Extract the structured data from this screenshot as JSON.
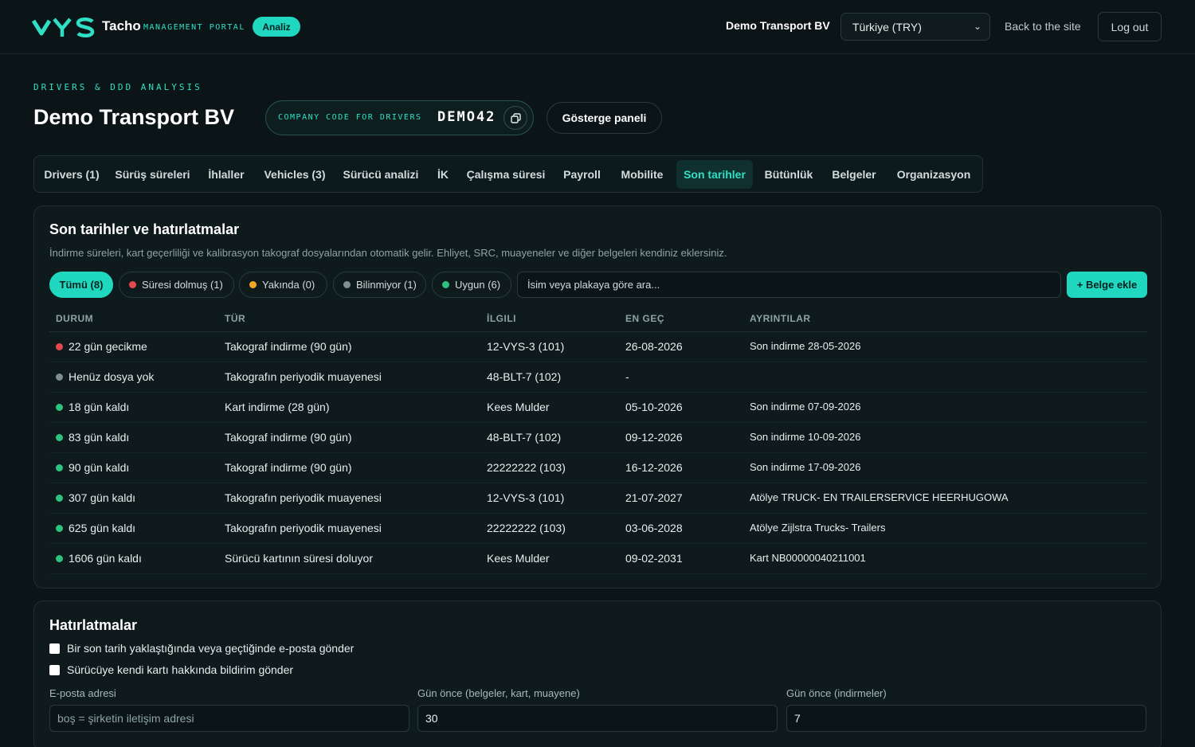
{
  "header": {
    "logo_text": "VYS",
    "brand": "Tacho",
    "portal_label": "MANAGEMENT PORTAL",
    "badge": "Analiz",
    "company": "Demo Transport BV",
    "currency_selected": "Türkiye (TRY)",
    "back_link": "Back to the site",
    "logout": "Log out"
  },
  "page": {
    "eyebrow": "DRIVERS & DDD ANALYSIS",
    "title": "Demo Transport BV",
    "code_label": "COMPANY CODE FOR DRIVERS",
    "code_value": "DEMO42",
    "dashboard_button": "Gösterge paneli"
  },
  "tabs": [
    {
      "label": "Drivers (1)"
    },
    {
      "label": "Sürüş süreleri"
    },
    {
      "label": "İhlaller"
    },
    {
      "label": "Vehicles (3)"
    },
    {
      "label": "Sürücü analizi"
    },
    {
      "label": "İK"
    },
    {
      "label": "Çalışma süresi"
    },
    {
      "label": "Payroll"
    },
    {
      "label": "Mobilite"
    },
    {
      "label": "Son tarihler",
      "active": true
    },
    {
      "label": "Bütünlük"
    },
    {
      "label": "Belgeler"
    },
    {
      "label": "Organizasyon"
    }
  ],
  "deadlines": {
    "title": "Son tarihler ve hatırlatmalar",
    "subtitle": "İndirme süreleri, kart geçerliliği ve kalibrasyon takograf dosyalarından otomatik gelir. Ehliyet, SRC, muayeneler ve diğer belgeleri kendiniz eklersiniz.",
    "filters": [
      {
        "label": "Tümü (8)",
        "active": true
      },
      {
        "label": "Süresi dolmuş (1)",
        "color": "#e5484d"
      },
      {
        "label": "Yakında (0)",
        "color": "#f5a524"
      },
      {
        "label": "Bilinmiyor (1)",
        "color": "#7f8e90"
      },
      {
        "label": "Uygun (6)",
        "color": "#2ec27e"
      }
    ],
    "search_placeholder": "İsim veya plakaya göre ara...",
    "add_button": "+ Belge ekle",
    "columns": [
      "DURUM",
      "TÜR",
      "İLGILI",
      "EN GEÇ",
      "AYRINTILAR"
    ],
    "rows": [
      {
        "status": "22 gün gecikme",
        "status_color": "#e5484d",
        "type": "Takograf indirme (90 gün)",
        "related": "12-VYS-3 (101)",
        "deadline": "26-08-2026",
        "details": "Son indirme 28-05-2026"
      },
      {
        "status": "Henüz dosya yok",
        "status_color": "#7f8e90",
        "type": "Takografın periyodik muayenesi",
        "related": "48-BLT-7 (102)",
        "deadline": "-",
        "details": ""
      },
      {
        "status": "18 gün kaldı",
        "status_color": "#2ec27e",
        "type": "Kart indirme (28 gün)",
        "related": "Kees Mulder",
        "deadline": "05-10-2026",
        "details": "Son indirme 07-09-2026"
      },
      {
        "status": "83 gün kaldı",
        "status_color": "#2ec27e",
        "type": "Takograf indirme (90 gün)",
        "related": "48-BLT-7 (102)",
        "deadline": "09-12-2026",
        "details": "Son indirme 10-09-2026"
      },
      {
        "status": "90 gün kaldı",
        "status_color": "#2ec27e",
        "type": "Takograf indirme (90 gün)",
        "related": "22222222 (103)",
        "deadline": "16-12-2026",
        "details": "Son indirme 17-09-2026"
      },
      {
        "status": "307 gün kaldı",
        "status_color": "#2ec27e",
        "type": "Takografın periyodik muayenesi",
        "related": "12-VYS-3 (101)",
        "deadline": "21-07-2027",
        "details": "Atölye TRUCK- EN TRAILERSERVICE HEERHUGOWA"
      },
      {
        "status": "625 gün kaldı",
        "status_color": "#2ec27e",
        "type": "Takografın periyodik muayenesi",
        "related": "22222222 (103)",
        "deadline": "03-06-2028",
        "details": "Atölye Zijlstra Trucks- Trailers"
      },
      {
        "status": "1606 gün kaldı",
        "status_color": "#2ec27e",
        "type": "Sürücü kartının süresi doluyor",
        "related": "Kees Mulder",
        "deadline": "09-02-2031",
        "details": "Kart NB00000040211001"
      }
    ]
  },
  "reminders": {
    "title": "Hatırlatmalar",
    "checkbox_email": "Bir son tarih yaklaştığında veya geçtiğinde e-posta gönder",
    "checkbox_driver": "Sürücüye kendi kartı hakkında bildirim gönder",
    "email_label": "E-posta adresi",
    "email_placeholder": "boş = şirketin iletişim adresi",
    "days_docs_label": "Gün önce (belgeler, kart, muayene)",
    "days_docs_value": "30",
    "days_downloads_label": "Gün önce (indirmeler)",
    "days_downloads_value": "7"
  }
}
